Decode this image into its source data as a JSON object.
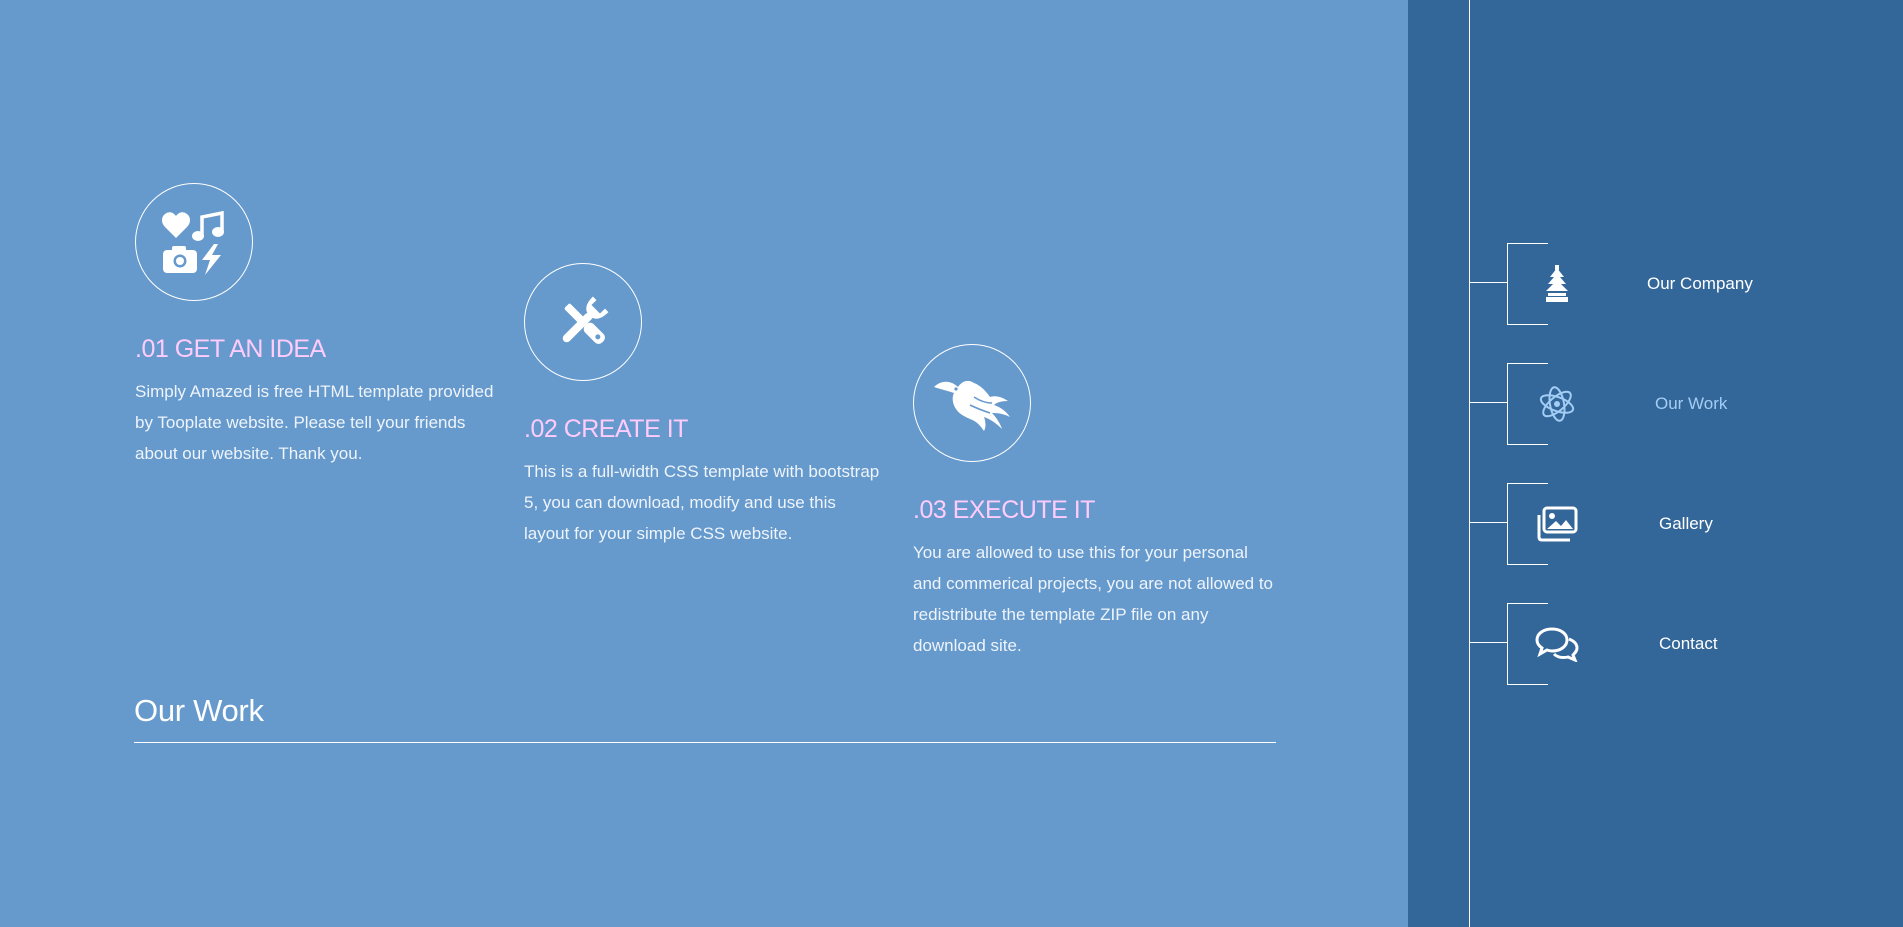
{
  "colors": {
    "main_background": "#6699cc",
    "sidebar_background": "#336699",
    "step_heading": "#ffccff",
    "active_nav": "#a3cdf5",
    "text": "#ffffff"
  },
  "steps": [
    {
      "icon": "heart-music-camera-bolt-icon",
      "title": ".01 GET AN IDEA",
      "text": "Simply Amazed is free HTML template provided by Tooplate website. Please tell your friends about our website. Thank you."
    },
    {
      "icon": "tools-icon",
      "title": ".02 CREATE IT",
      "text": "This is a full-width CSS template with bootstrap 5, you can download, modify and use this layout for your simple CSS website."
    },
    {
      "icon": "phoenix-icon",
      "title": ".03 EXECUTE IT",
      "text": "You are allowed to use this for your personal and commerical projects, you are not allowed to redistribute the template ZIP file on any download site."
    }
  ],
  "section": {
    "title": "Our Work"
  },
  "nav": {
    "items": [
      {
        "label": "Our Company",
        "icon": "tree-icon",
        "active": false
      },
      {
        "label": "Our Work",
        "icon": "atom-icon",
        "active": true
      },
      {
        "label": "Gallery",
        "icon": "images-icon",
        "active": false
      },
      {
        "label": "Contact",
        "icon": "chat-bubbles-icon",
        "active": false
      }
    ]
  }
}
